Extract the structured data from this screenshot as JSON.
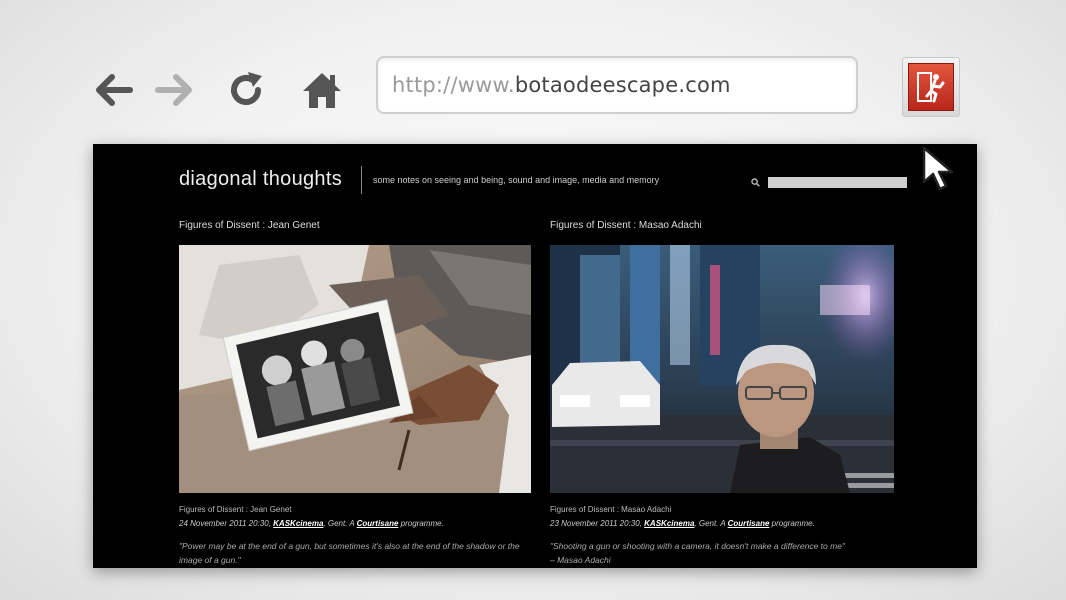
{
  "browser": {
    "url_protocol": "http://www.",
    "url_domain": "botaodeescape.com",
    "nav_color": "#555555",
    "exit_color": "#c8321f"
  },
  "site": {
    "title": "diagonal thoughts",
    "tagline": "some notes on seeing and being, sound and image, media and memory"
  },
  "posts": [
    {
      "header": "Figures of Dissent : Jean Genet",
      "meta_title": "Figures of Dissent : Jean Genet",
      "date": "24 November 2011 20:30,",
      "link1": "KASKcinema",
      "mid": ", Gent. A",
      "link2": "Courtisane",
      "end": "programme.",
      "quote": "\"Power may be at the end of a gun, but sometimes it's also at the end of the shadow or the image of a gun.\""
    },
    {
      "header": "Figures of Dissent : Masao Adachi",
      "meta_title": "Figures of Dissent : Masao Adachi",
      "date": "23 November 2011 20:30,",
      "link1": "KASKcinema",
      "mid": ", Gent. A",
      "link2": "Courtisane",
      "end": "programme.",
      "quote": "\"Shooting a gun or shooting with a camera, it doesn't make a difference to me\"",
      "quote_attr": "– Masao Adachi"
    }
  ]
}
